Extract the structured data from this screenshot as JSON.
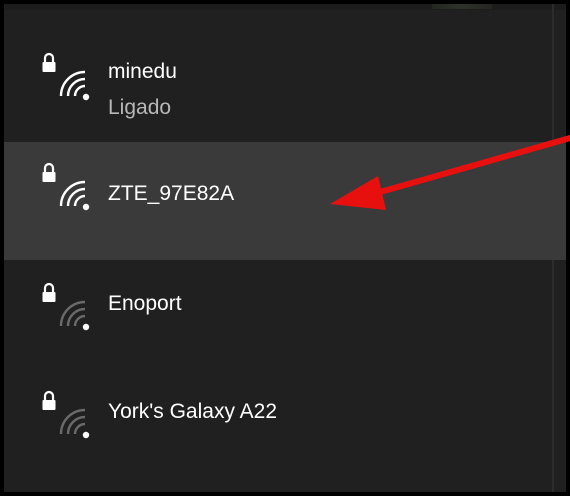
{
  "networks": [
    {
      "ssid": "minedu",
      "status": "Ligado",
      "secured": true,
      "connected": true,
      "highlighted": false,
      "icon": "wifi-secured-icon"
    },
    {
      "ssid": "ZTE_97E82A",
      "status": "",
      "secured": true,
      "connected": false,
      "highlighted": true,
      "icon": "wifi-secured-icon"
    },
    {
      "ssid": "Enoport",
      "status": "",
      "secured": true,
      "connected": false,
      "highlighted": false,
      "icon": "wifi-secured-weak-icon"
    },
    {
      "ssid": "York's Galaxy A22",
      "status": "",
      "secured": true,
      "connected": false,
      "highlighted": false,
      "icon": "wifi-secured-weak-icon"
    }
  ],
  "annotation": {
    "icon": "red-arrow-annotation",
    "color": "#e8100f"
  },
  "colors": {
    "panel_background": "#202020",
    "highlight_background": "#3a3a3a",
    "border": "#000000",
    "text_primary": "#ffffff",
    "text_secondary": "#b8b8b8"
  }
}
